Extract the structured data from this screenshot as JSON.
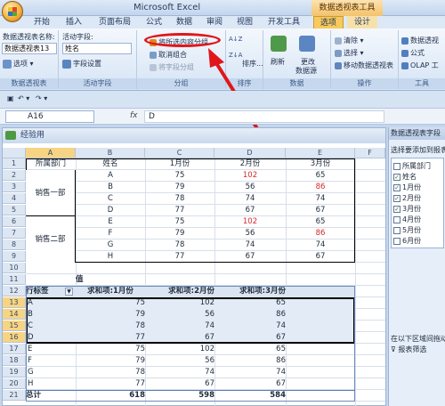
{
  "app": {
    "title": "Microsoft Excel",
    "context_title": "数据透视表工具"
  },
  "tabs": [
    "开始",
    "插入",
    "页面布局",
    "公式",
    "数据",
    "审阅",
    "视图",
    "开发工具",
    "选项",
    "设计"
  ],
  "ribbon": {
    "pivot_name_label": "数据透视表名称:",
    "pivot_name_value": "数据透视表13",
    "options_label": "选项",
    "group_pivot": "数据透视表",
    "active_field_label": "活动字段:",
    "active_field_value": "姓名",
    "field_settings_label": "字段设置",
    "group_active_field": "活动字段",
    "group_selection": "将所选内容分组",
    "ungroup": "取消组合",
    "group_field": "将字段分组",
    "group_group": "分组",
    "sort_label": "排序...",
    "group_sort": "排序",
    "refresh": "刷新",
    "change_source_1": "更改",
    "change_source_2": "数据源",
    "group_data": "数据",
    "clear": "清除",
    "select": "选择",
    "move_pivot": "移动数据透视表",
    "group_actions": "操作",
    "pivot_chart": "数据透视",
    "formulas": "公式",
    "olap": "OLAP 工",
    "group_tools": "工具"
  },
  "formula_bar": {
    "cell_ref": "A16",
    "fx": "fx",
    "value": "D"
  },
  "workbook": {
    "title": "经验用",
    "columns": [
      "A",
      "B",
      "C",
      "D",
      "E",
      "F"
    ],
    "rows": [
      "1",
      "2",
      "3",
      "4",
      "5",
      "6",
      "7",
      "8",
      "9",
      "10",
      "11",
      "12",
      "13",
      "14",
      "15",
      "16",
      "17",
      "18",
      "19",
      "20",
      "21"
    ],
    "headers": [
      "所属部门",
      "姓名",
      "1月份",
      "2月份",
      "3月份"
    ],
    "dept1": "销售一部",
    "dept2": "销售二部",
    "data": [
      [
        "A",
        "75",
        "102",
        "65"
      ],
      [
        "B",
        "79",
        "56",
        "86"
      ],
      [
        "C",
        "78",
        "74",
        "74"
      ],
      [
        "D",
        "77",
        "67",
        "67"
      ],
      [
        "E",
        "75",
        "102",
        "65"
      ],
      [
        "F",
        "79",
        "56",
        "86"
      ],
      [
        "G",
        "78",
        "74",
        "74"
      ],
      [
        "H",
        "77",
        "67",
        "67"
      ]
    ],
    "pivot": {
      "value_label": "值",
      "row_label": "行标签",
      "sum1": "求和项:1月份",
      "sum2": "求和项:2月份",
      "sum3": "求和项:3月份",
      "total_label": "总计",
      "totals": [
        "618",
        "598",
        "584"
      ]
    }
  },
  "field_panel": {
    "title": "数据透视表字段",
    "prompt": "选择要添加到报表",
    "fields": [
      {
        "name": "所属部门",
        "checked": false
      },
      {
        "name": "姓名",
        "checked": true
      },
      {
        "name": "1月份",
        "checked": true
      },
      {
        "name": "2月份",
        "checked": true
      },
      {
        "name": "3月份",
        "checked": true
      },
      {
        "name": "4月份",
        "checked": false
      },
      {
        "name": "5月份",
        "checked": false
      },
      {
        "name": "6月份",
        "checked": false
      }
    ],
    "drag_hint": "在以下区域间拖动",
    "report_filter": "报表筛选"
  },
  "colors": {
    "accent": "#f8c95b",
    "red_value": "#d42a2a",
    "annotation": "#e0161b"
  }
}
